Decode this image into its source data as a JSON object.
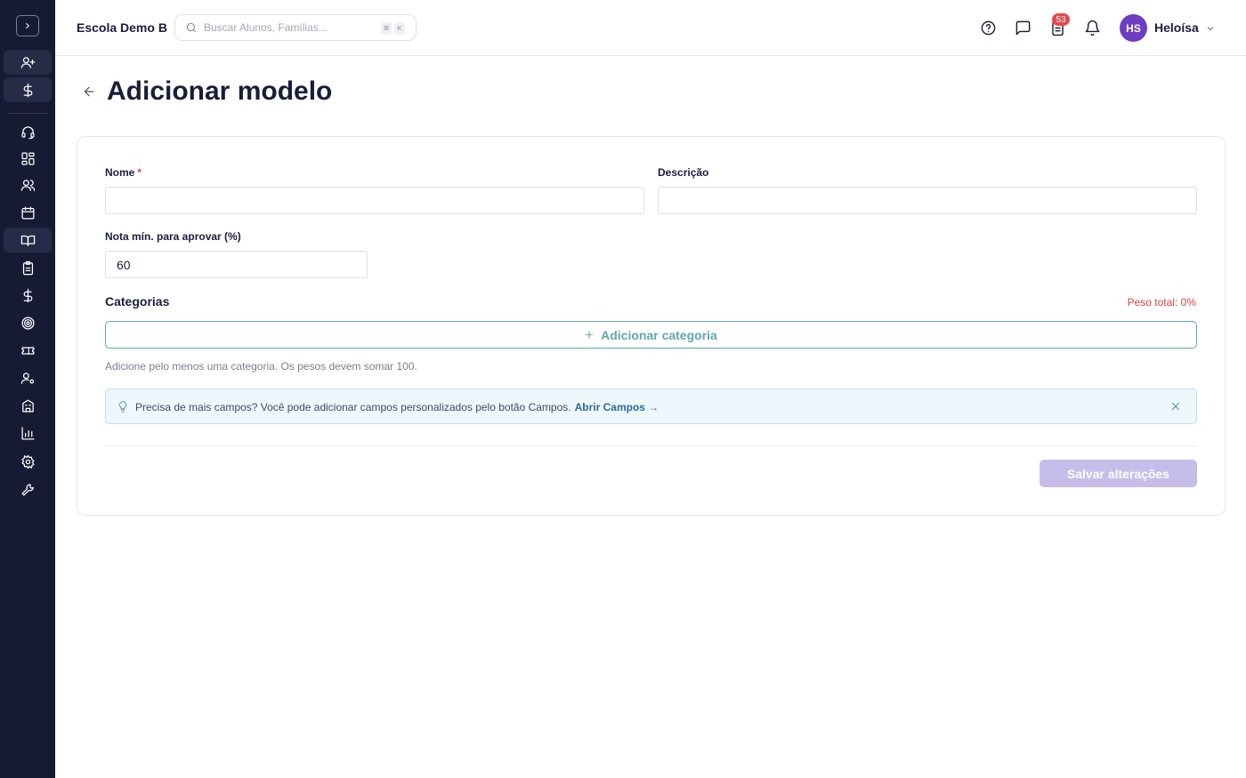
{
  "sidebar": {
    "items": [
      {
        "icon": "user-plus-icon"
      },
      {
        "icon": "dollar-icon"
      },
      {
        "icon": "headset-icon"
      },
      {
        "icon": "dashboard-icon"
      },
      {
        "icon": "users-icon"
      },
      {
        "icon": "calendar-icon"
      },
      {
        "icon": "book-open-icon"
      },
      {
        "icon": "clipboard-icon"
      },
      {
        "icon": "dollar-icon"
      },
      {
        "icon": "target-icon"
      },
      {
        "icon": "ticket-icon"
      },
      {
        "icon": "user-cog-icon"
      },
      {
        "icon": "building-icon"
      },
      {
        "icon": "bar-chart-icon"
      },
      {
        "icon": "settings-icon"
      },
      {
        "icon": "wrench-icon"
      }
    ]
  },
  "header": {
    "school_name": "Escola Demo B",
    "search_placeholder": "Buscar Alunos, Famílias...",
    "search_kbd_1": "⌘",
    "search_kbd_2": "K",
    "notifications_badge": "53",
    "avatar_initials": "HS",
    "user_name": "Heloísa"
  },
  "page": {
    "title": "Adicionar modelo"
  },
  "form": {
    "name_label": "Nome",
    "name_required": "*",
    "name_value": "",
    "description_label": "Descrição",
    "description_value": "",
    "min_grade_label": "Nota mín. para aprovar (%)",
    "min_grade_value": "60",
    "categories_title": "Categorias",
    "total_weight": "Peso total: 0%",
    "add_category_label": "Adicionar categoria",
    "add_category_plus": "+",
    "categories_hint": "Adicione pelo menos uma categoria. Os pesos devem somar 100.",
    "info_text": "Precisa de mais campos? Você pode adicionar campos personalizados pelo botão Campos.",
    "info_link": "Abrir Campos →",
    "save_label": "Salvar alterações"
  },
  "colors": {
    "sidebar_bg": "#161a33",
    "accent_teal": "#5fa7b0",
    "save_disabled": "#c7bdea",
    "avatar": "#6d3ec4",
    "badge": "#e5484d",
    "warning_text": "#d14343"
  }
}
